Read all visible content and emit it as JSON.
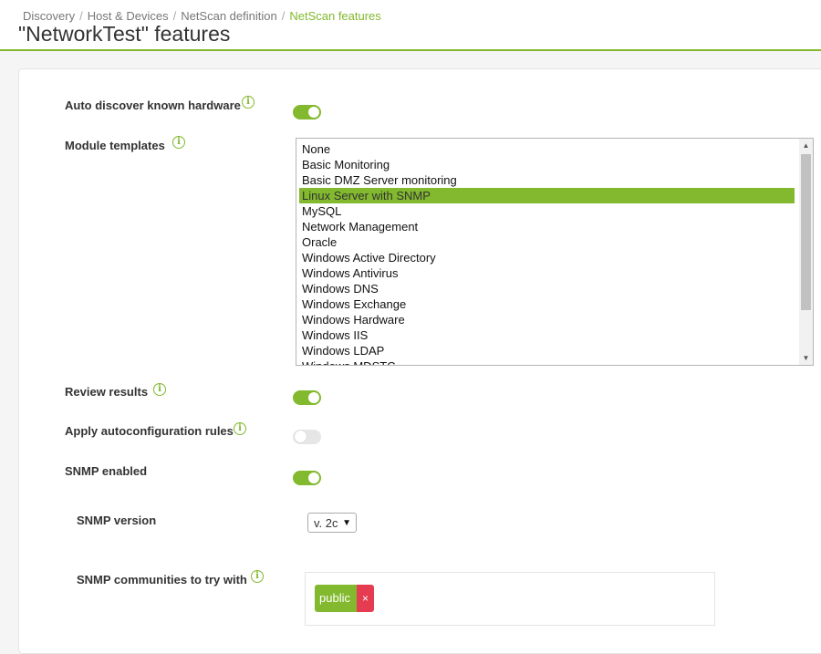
{
  "breadcrumb": {
    "items": [
      "Discovery",
      "Host & Devices",
      "NetScan definition"
    ],
    "current": "NetScan features",
    "separator": "/"
  },
  "page": {
    "title": "\"NetworkTest\" features"
  },
  "form": {
    "auto_discover": {
      "label": "Auto discover known hardware",
      "enabled": true
    },
    "module_templates": {
      "label": "Module templates",
      "options": [
        "None",
        "Basic Monitoring",
        "Basic DMZ Server monitoring",
        "Linux Server with SNMP",
        "MySQL",
        "Network Management",
        "Oracle",
        "Windows Active Directory",
        "Windows Antivirus",
        "Windows DNS",
        "Windows Exchange",
        "Windows Hardware",
        "Windows IIS",
        "Windows LDAP",
        "Windows MDSTC"
      ],
      "selected": "Linux Server with SNMP"
    },
    "review_results": {
      "label": "Review results",
      "enabled": true
    },
    "apply_autoconfig": {
      "label": "Apply autoconfiguration rules",
      "enabled": false
    },
    "snmp_enabled": {
      "label": "SNMP enabled",
      "enabled": true
    },
    "snmp_version": {
      "label": "SNMP version",
      "value": "v. 2c"
    },
    "snmp_communities": {
      "label": "SNMP communities to try with",
      "tags": [
        "public"
      ],
      "remove_glyph": "×"
    }
  },
  "icons": {
    "info": "i",
    "dropdown_arrow": "▼",
    "scroll_up": "▲",
    "scroll_down": "▼"
  },
  "colors": {
    "accent": "#82b92e",
    "danger": "#e63c52",
    "toggle_off": "#e6e6e6"
  }
}
